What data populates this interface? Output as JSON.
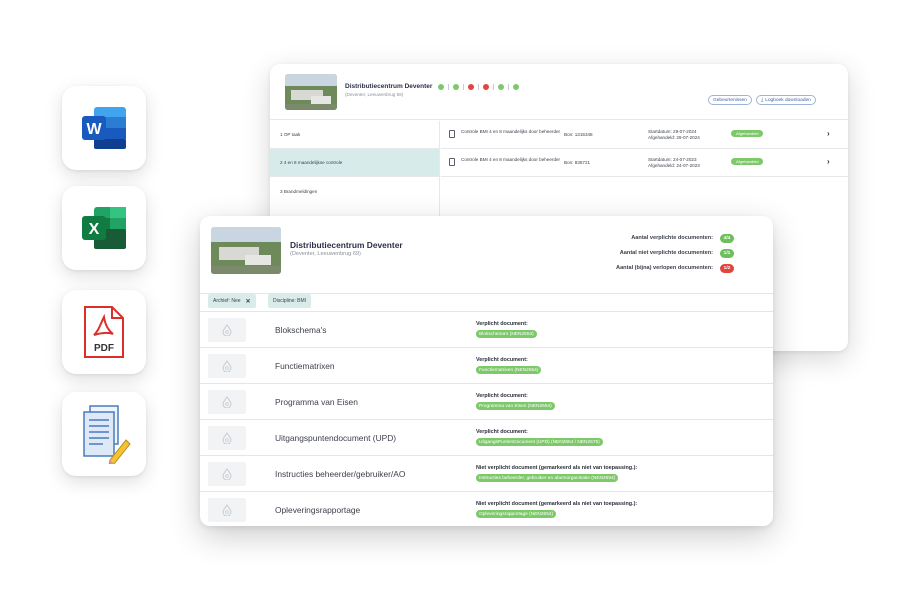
{
  "files": [
    {
      "icon": "word-icon",
      "letter": "W",
      "color": "#185abd"
    },
    {
      "icon": "excel-icon",
      "letter": "X",
      "color": "#107c41"
    },
    {
      "icon": "pdf-icon",
      "label": "PDF",
      "color": "#d9302c"
    },
    {
      "icon": "document-edit-icon"
    }
  ],
  "back_window": {
    "title": "Distributiecentrum Deventer",
    "subtitle": "(Deventer, Leeuwenbrug 69)",
    "buttons": [
      "Gebeurtenissen",
      "Logboek downloaden"
    ],
    "sidebar": [
      {
        "label": "1   OP taak"
      },
      {
        "label": "2   4 en 8 maandelijkse controle",
        "active": true
      },
      {
        "label": "3   Brandmeldingen"
      }
    ],
    "rows": [
      {
        "task": "Controle BMI 4 en 8 maandelijks door beheerder",
        "bon": "Bon: 1315348",
        "start": "Startdatum: 29-07-2024",
        "end": "Afgehandeld: 29-07-2024",
        "status": "Afgehandeld"
      },
      {
        "task": "Controle BMI 4 en 8 maandelijks door beheerder",
        "bon": "Bon: 836721",
        "start": "Startdatum: 24-07-2023",
        "end": "Afgehandeld: 24-07-2023",
        "status": "Afgehandeld"
      }
    ]
  },
  "front_window": {
    "title": "Distributiecentrum Deventer",
    "subtitle": "(Deventer, Leeuwenbrug 69)",
    "stats": [
      {
        "label": "Aantal verplichte documenten:",
        "value": "4/4",
        "color": "#6cbf5c"
      },
      {
        "label": "Aantal niet verplichte documenten:",
        "value": "1/1",
        "color": "#6cbf5c"
      },
      {
        "label": "Aantal (bijna) verlopen documenten:",
        "value": "1/2",
        "color": "#e0453e"
      }
    ],
    "filters": [
      {
        "label": "Archief: Nee",
        "closable": true
      },
      {
        "label": "Discipline: BMI",
        "closable": false
      }
    ],
    "rows": [
      {
        "name": "Blokschema's",
        "status": "Verplicht document:",
        "doc": "Blokschema's (NEN2654)"
      },
      {
        "name": "Functiematrixen",
        "status": "Verplicht document:",
        "doc": "Functiematrixen (NEN2654)"
      },
      {
        "name": "Programma van Eisen",
        "status": "Verplicht document:",
        "doc": "Programma van Eisen (NEN2654)"
      },
      {
        "name": "Uitgangspuntendocument (UPD)",
        "status": "Verplicht document:",
        "doc": "UitgangsPuntenDocument (UPD) (NEN2654 / NEN2575)"
      },
      {
        "name": "Instructies beheerder/gebruiker/AO",
        "status": "Niet verplicht document (gemarkeerd als niet van toepassing.):",
        "doc": "Instructies beheerder, gebruiker en alarmorganisatie (NEN2654)"
      },
      {
        "name": "Opleveringsrapportage",
        "status": "Niet verplicht document (gemarkeerd als niet van toepassing.):",
        "doc": "Opleveringsrapportage (NEN2654)"
      }
    ]
  }
}
